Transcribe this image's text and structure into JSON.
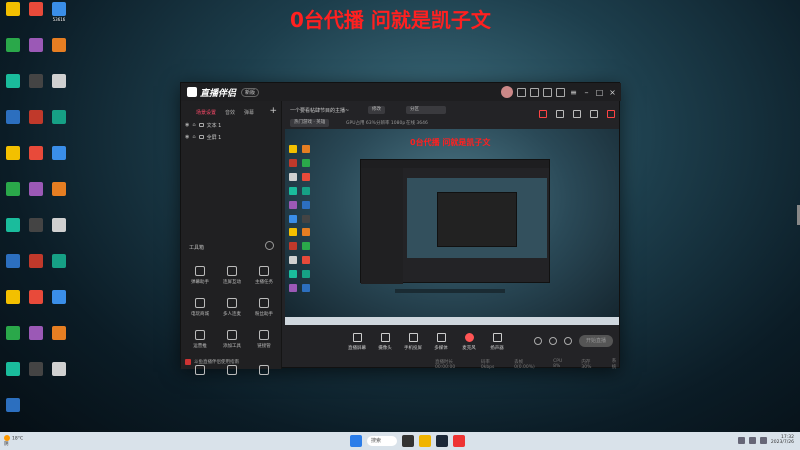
{
  "overlay_title": "0台代播 问就是凯子文",
  "desktop": {
    "icon_labels": [
      "",
      "",
      "53616",
      "",
      "",
      "",
      "",
      "",
      "",
      "",
      "",
      "",
      "",
      "",
      "",
      "",
      "",
      "",
      "",
      "",
      "",
      "",
      "",
      "",
      "",
      "",
      "",
      "",
      "",
      "",
      "",
      "",
      "",
      ""
    ]
  },
  "app": {
    "logo_text": "直播伴侣",
    "version_label": "新版",
    "tabs": [
      "场景设置",
      "音效",
      "弹幕"
    ],
    "active_tab": 0,
    "sources": [
      {
        "name": "文本 1"
      },
      {
        "name": "全屏 1"
      }
    ],
    "tools_header": "工具箱",
    "tools": [
      {
        "label": "弹幕助手"
      },
      {
        "label": "连屏互动"
      },
      {
        "label": "主播任务"
      },
      {
        "label": "电玩商城"
      },
      {
        "label": "多人连麦"
      },
      {
        "label": "粉丝助手"
      },
      {
        "label": "运营推"
      },
      {
        "label": "添加工具"
      },
      {
        "label": "链接管"
      },
      {
        "label": ""
      },
      {
        "label": ""
      },
      {
        "label": ""
      }
    ],
    "left_footer": "斗鱼直播伴侣使用指南",
    "room_title": "一个要看帖肆节目的主播~",
    "pill_edit": "修改",
    "pill_category": "分区",
    "tag": "热门游戏 · 英雄",
    "stats": [
      "GPU占用  63%",
      "分辨率 1080p",
      "在线  3646"
    ],
    "preview_overlay": "0台代播 问就是凯子文",
    "controls": [
      {
        "label": "直播屏幕"
      },
      {
        "label": "摄像头"
      },
      {
        "label": "手机投屏"
      },
      {
        "label": "多媒体"
      },
      {
        "label": "麦克风"
      },
      {
        "label": "扬声器"
      }
    ],
    "start_button": "开始直播",
    "status": [
      "直播时长 00:00:00",
      "码率 0kbps",
      "丢帧 0(0.00%)",
      "CPU 8%",
      "内存 30%",
      "系统"
    ]
  },
  "taskbar": {
    "weather_temp": "18°C",
    "weather_desc": "阴",
    "search_label": "搜索",
    "time": "17:32",
    "date": "2023/7/26"
  },
  "colors": {
    "overlay_red": "#ff2020",
    "active_tab": "#ff4a6a",
    "app_bg": "#232326"
  }
}
